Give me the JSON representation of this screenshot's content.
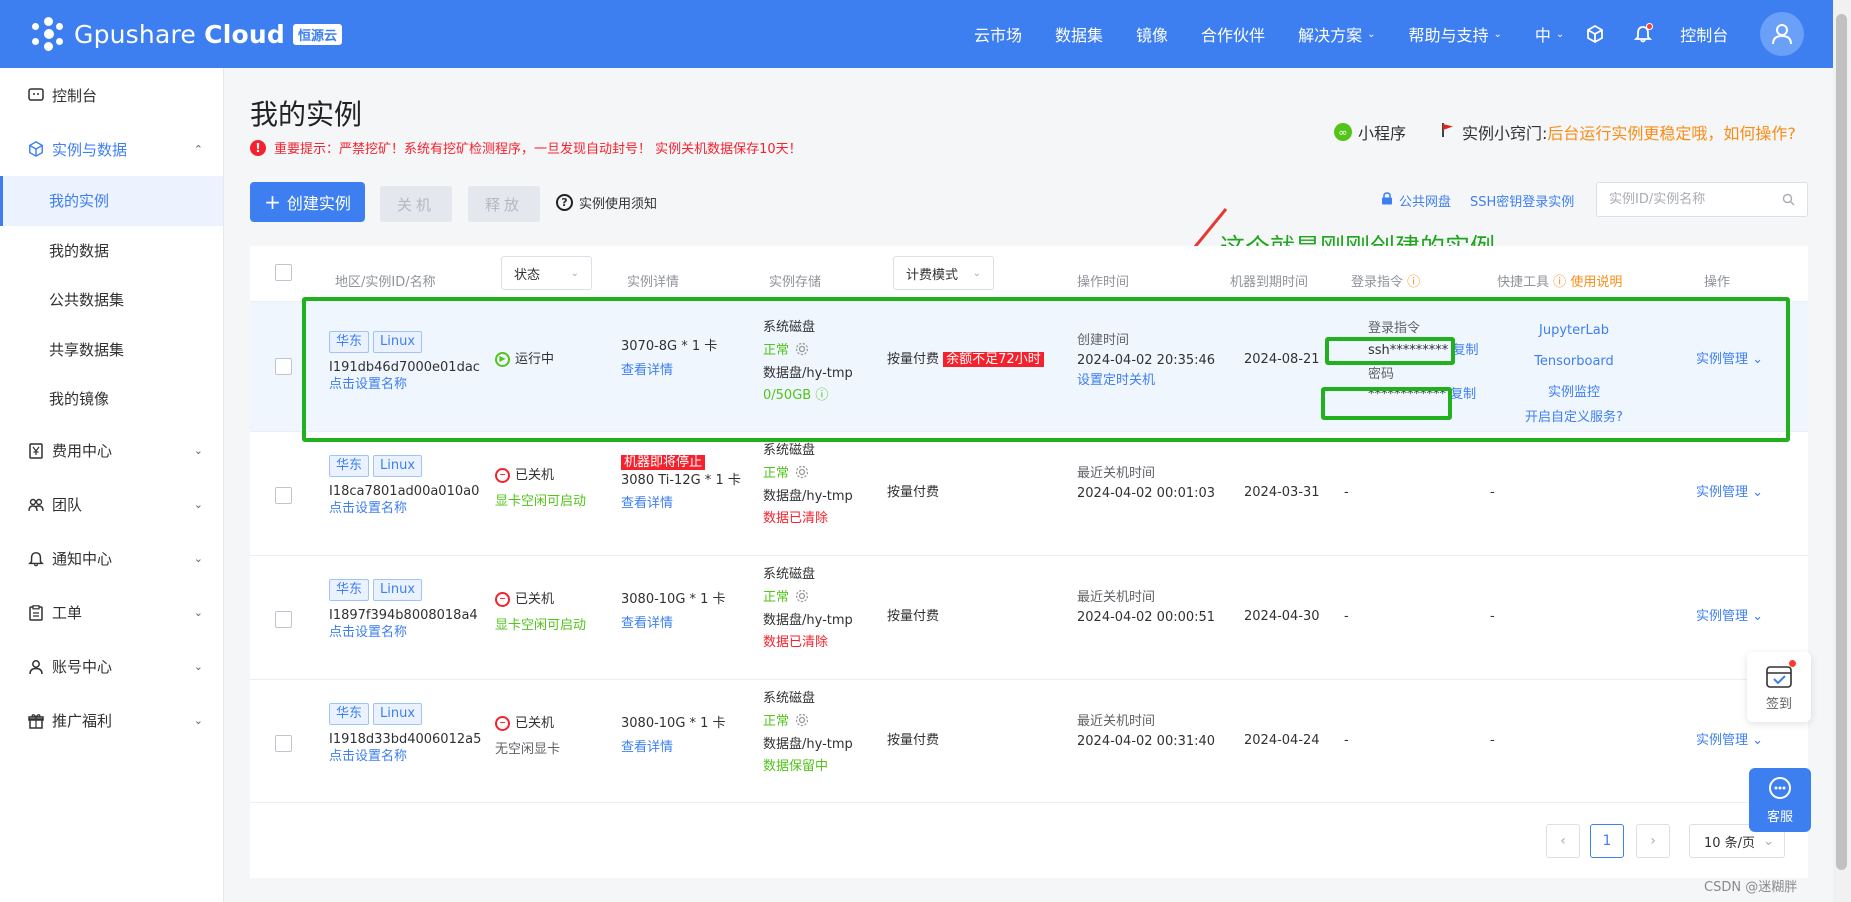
{
  "brand": {
    "name_light": "Gpushare",
    "name_bold": "Cloud",
    "badge": "恒源云"
  },
  "nav": {
    "items": [
      "云市场",
      "数据集",
      "镜像",
      "合作伙伴"
    ],
    "solutions": "解决方案",
    "help": "帮助与支持",
    "lang": "中",
    "console": "控制台"
  },
  "sidebar": {
    "console": "控制台",
    "instances_group": "实例与数据",
    "sub": [
      "我的实例",
      "我的数据",
      "公共数据集",
      "共享数据集",
      "我的镜像"
    ],
    "groups": [
      "费用中心",
      "团队",
      "通知中心",
      "工单",
      "账号中心",
      "推广福利"
    ]
  },
  "page": {
    "title": "我的实例",
    "warning": "重要提示：严禁挖矿！系统有挖矿检测程序，一旦发现自动封号！ 实例关机数据保存10天！",
    "mini_program": "小程序",
    "tips_label": "实例小窍门:",
    "tips_link": "后台运行实例更稳定哦，如何操作?"
  },
  "toolbar": {
    "create": "创建实例",
    "shutdown": "关机",
    "release": "释放",
    "notice": "实例使用须知",
    "netdisk": "公共网盘",
    "ssh_login": "SSH密钥登录实例",
    "search_placeholder": "实例ID/实例名称"
  },
  "table": {
    "headers": {
      "region": "地区/实例ID/名称",
      "status": "状态",
      "detail": "实例详情",
      "storage": "实例存储",
      "billing": "计费模式",
      "op_time": "操作时间",
      "expire": "机器到期时间",
      "login": "登录指令",
      "tools": "快捷工具",
      "usage": "使用说明",
      "actions": "操作"
    },
    "rows": [
      {
        "region": "华东",
        "os": "Linux",
        "id": "I191db46d7000e01dac",
        "set_name": "点击设置名称",
        "status": "运行中",
        "status_sub": "",
        "warn_badge": "",
        "gpu": "3070-8G * 1 卡",
        "view": "查看详情",
        "disk_label": "系统磁盘",
        "disk_state": "正常",
        "data_disk": "数据盘/hy-tmp",
        "data_state": "0/50GB",
        "billing": "按量付费",
        "billing_badge": "余额不足72小时",
        "time_label": "创建时间",
        "time": "2024-04-02 20:35:46",
        "time_link": "设置定时关机",
        "expire": "2024-08-21",
        "login_label": "登录指令",
        "login_value": "ssh*********",
        "copy": "复制",
        "pwd_label": "密码",
        "pwd_value": "************",
        "tools": [
          "JupyterLab",
          "Tensorboard",
          "实例监控",
          "开启自定义服务?"
        ],
        "manage": "实例管理"
      },
      {
        "region": "华东",
        "os": "Linux",
        "id": "I18ca7801ad00a010a0",
        "set_name": "点击设置名称",
        "status": "已关机",
        "status_sub": "显卡空闲可启动",
        "warn_badge": "机器即将停止",
        "gpu": "3080 Ti-12G * 1 卡",
        "view": "查看详情",
        "disk_label": "系统磁盘",
        "disk_state": "正常",
        "data_disk": "数据盘/hy-tmp",
        "data_state": "数据已清除",
        "billing": "按量付费",
        "time_label": "最近关机时间",
        "time": "2024-04-02 00:01:03",
        "expire": "2024-03-31",
        "login": "-",
        "tools": "-",
        "manage": "实例管理"
      },
      {
        "region": "华东",
        "os": "Linux",
        "id": "I1897f394b8008018a4",
        "set_name": "点击设置名称",
        "status": "已关机",
        "status_sub": "显卡空闲可启动",
        "gpu": "3080-10G * 1 卡",
        "view": "查看详情",
        "disk_label": "系统磁盘",
        "disk_state": "正常",
        "data_disk": "数据盘/hy-tmp",
        "data_state": "数据已清除",
        "billing": "按量付费",
        "time_label": "最近关机时间",
        "time": "2024-04-02 00:00:51",
        "expire": "2024-04-30",
        "login": "-",
        "tools": "-",
        "manage": "实例管理"
      },
      {
        "region": "华东",
        "os": "Linux",
        "id": "I1918d33bd4006012a5",
        "set_name": "点击设置名称",
        "status": "已关机",
        "status_sub": "无空闲显卡",
        "gpu": "3080-10G * 1 卡",
        "view": "查看详情",
        "disk_label": "系统磁盘",
        "disk_state": "正常",
        "data_disk": "数据盘/hy-tmp",
        "data_state": "数据保留中",
        "billing": "按量付费",
        "time_label": "最近关机时间",
        "time": "2024-04-02 00:31:40",
        "expire": "2024-04-24",
        "login": "-",
        "tools": "-",
        "manage": "实例管理"
      }
    ]
  },
  "annotation": "这个就是刚刚创建的实例",
  "pagination": {
    "page": "1",
    "size": "10 条/页"
  },
  "float": {
    "sign": "签到",
    "service": "客服"
  },
  "watermark": "CSDN @迷糊胖"
}
